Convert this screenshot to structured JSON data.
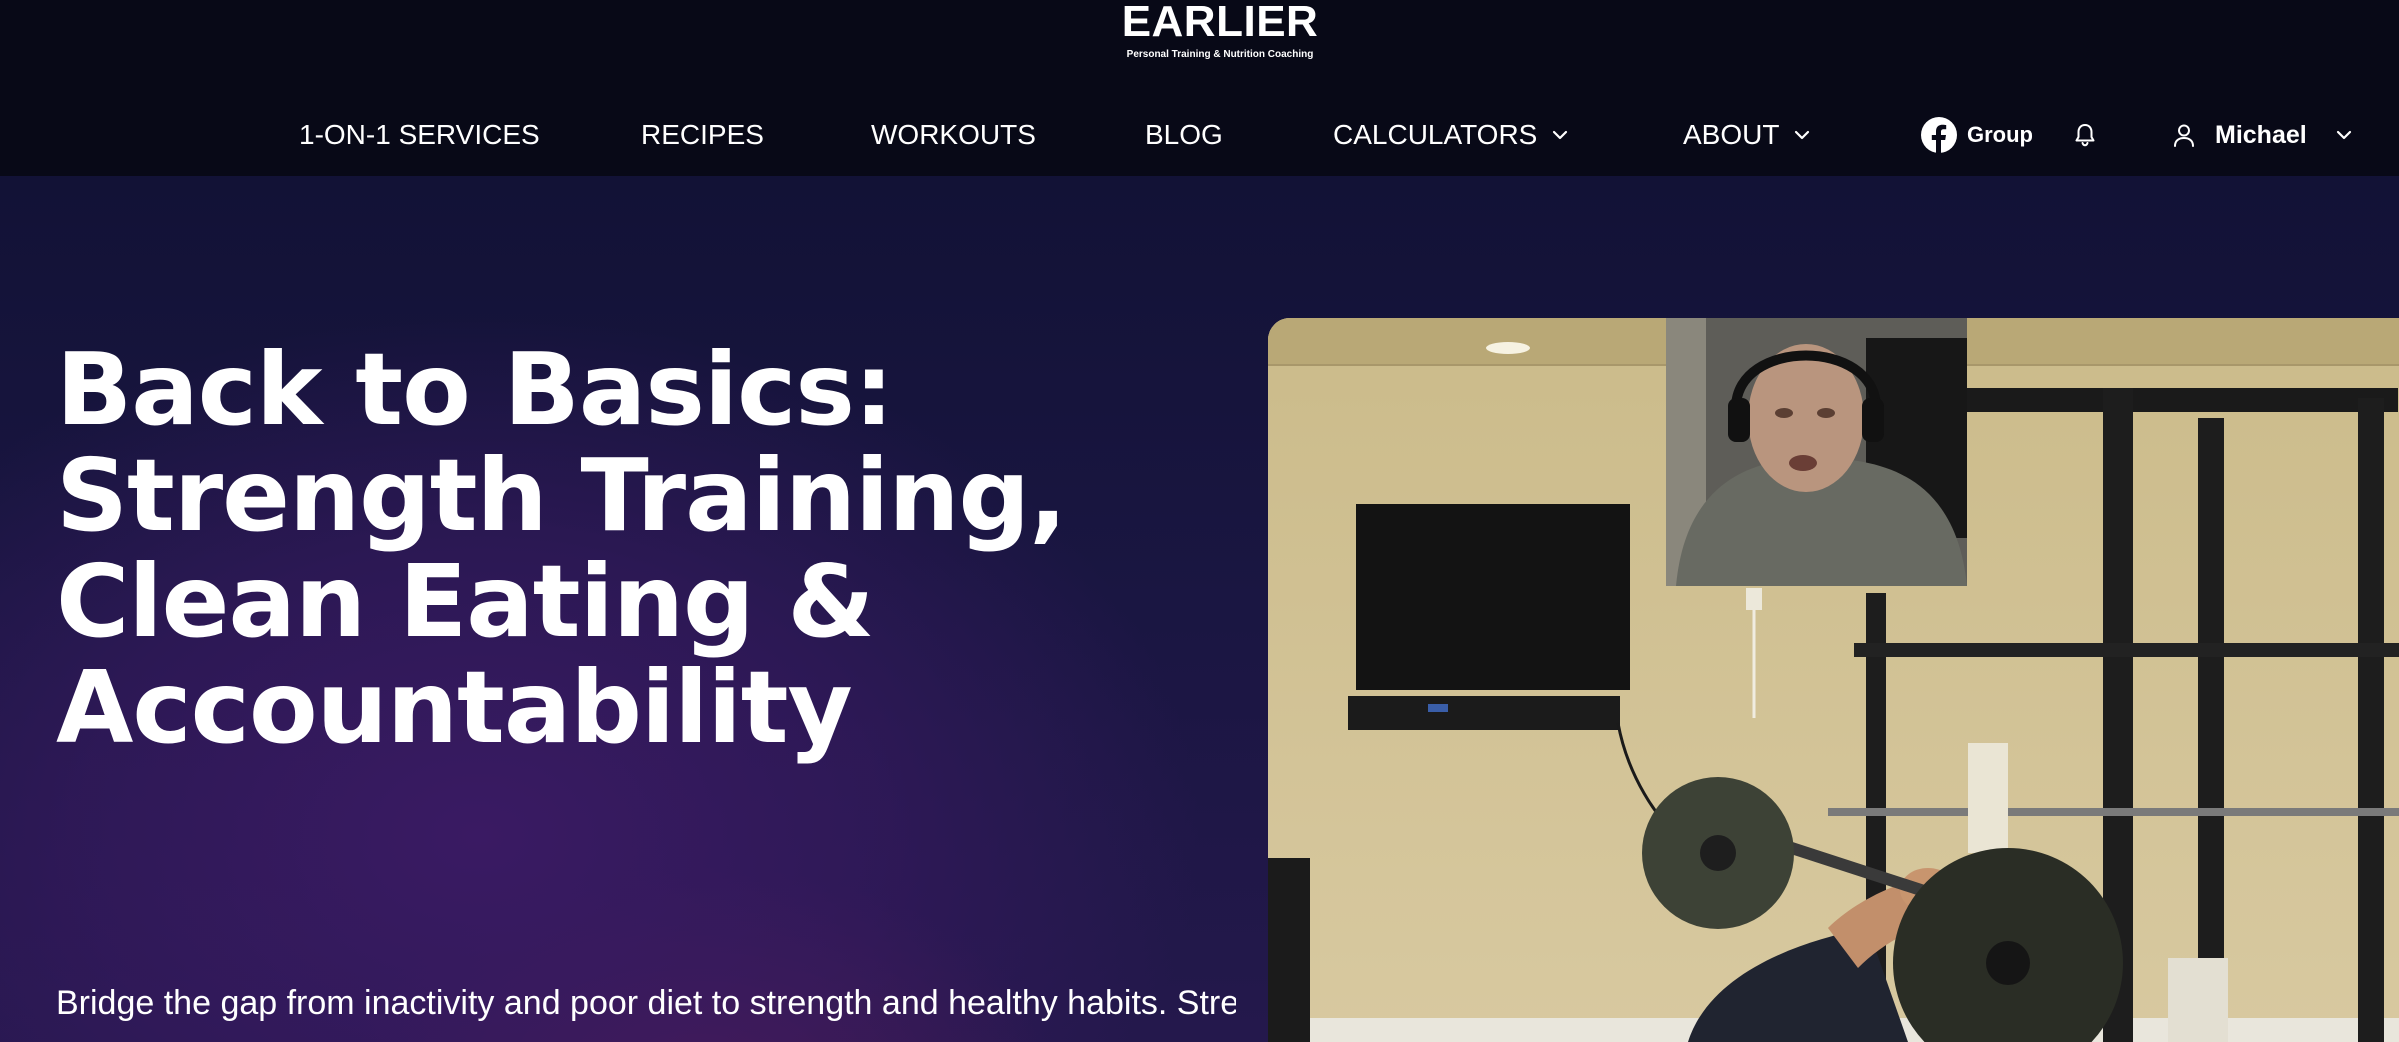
{
  "logo": {
    "title": "EARLIER",
    "subtitle": "Personal Training & Nutrition Coaching"
  },
  "nav": {
    "items": [
      {
        "label": "1-ON-1 SERVICES"
      },
      {
        "label": "RECIPES"
      },
      {
        "label": "WORKOUTS"
      },
      {
        "label": "BLOG"
      },
      {
        "label": "CALCULATORS",
        "icon": "chevron-down-icon"
      },
      {
        "label": "ABOUT",
        "icon": "chevron-down-icon"
      }
    ],
    "group_label": "Group",
    "group_icon": "facebook-icon",
    "notifications_icon": "bell-icon",
    "user_icon": "user-icon",
    "user_name": "Michael"
  },
  "hero": {
    "title_lines": [
      "Back to Basics:",
      "Strength Training,",
      "Clean Eating &",
      "Accountability"
    ],
    "text": "Bridge the gap from inactivity and poor diet to strength and healthy habits. Strength training, nutrition coaching and accountability that"
  },
  "colors": {
    "header_bg": "#080917",
    "hero_bg": "#1a1642",
    "hero_glow": "#3a1a63",
    "text": "#ffffff"
  }
}
